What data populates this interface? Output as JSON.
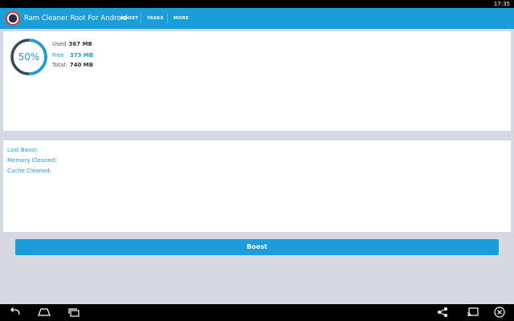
{
  "status_bar": {
    "time": "17:35"
  },
  "action_bar": {
    "app_name": "Ram Cleaner Root For Android",
    "tabs": [
      {
        "label": "BOOST"
      },
      {
        "label": "TASKS"
      },
      {
        "label": "MORE"
      }
    ]
  },
  "memory": {
    "percent_label": "50%",
    "percent_value": 0.5,
    "used_label": "Used",
    "used_value": "367 MB",
    "free_label": "Free",
    "free_value": "373 MB",
    "total_label": "Total:",
    "total_value": "740 MB"
  },
  "boost_info": {
    "last_boost_label": "Last Boost:",
    "memory_cleaned_label": "Memory Cleaned:",
    "cache_cleaned_label": "Cache Cleaned:"
  },
  "boost_button": {
    "label": "Boost"
  },
  "colors": {
    "accent": "#1a9dd9",
    "gauge_track": "#3a4a55",
    "background": "#d5d9e2"
  },
  "icons": {
    "app_logo": "app-logo-icon",
    "back": "back-icon",
    "home": "home-icon",
    "recent_apps": "recent-apps-icon",
    "share": "share-icon",
    "cast": "cast-icon",
    "close": "close-icon"
  }
}
